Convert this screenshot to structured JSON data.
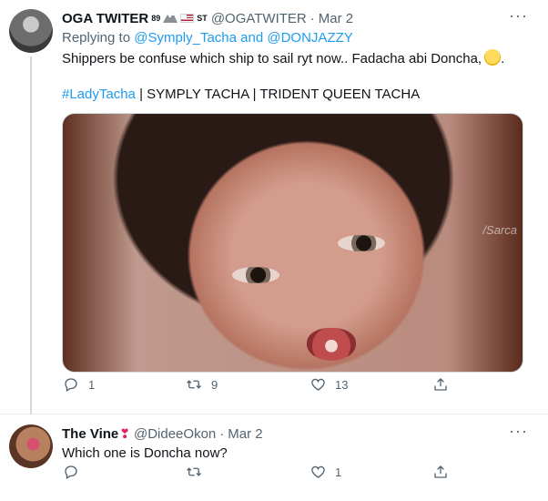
{
  "tweets": [
    {
      "author": {
        "name": "OGA TWITER",
        "superscript": "89",
        "rank": "ST",
        "handle": "@OGATWITER"
      },
      "date": "Mar 2",
      "reply_prefix": "Replying to",
      "reply_to": {
        "first": "@Symply_Tacha",
        "connector": "and",
        "second": "@DONJAZZY"
      },
      "text": "Shippers be confuse which ship to sail ryt now.. Fadacha abi Doncha,",
      "text_end": ".",
      "hashtag": "#LadyTacha",
      "tags_rest": "| SYMPLY TACHA | TRIDENT QUEEN TACHA",
      "media_watermark": "/Sarca",
      "actions": {
        "reply": "1",
        "retweet": "9",
        "like": "13"
      }
    },
    {
      "author": {
        "name": "The Vine",
        "handle": "@DideeOkon"
      },
      "date": "Mar 2",
      "text": "Which one is Doncha now?",
      "actions": {
        "reply": "",
        "retweet": "",
        "like": "1"
      }
    }
  ],
  "ui": {
    "dot": "·",
    "menu": "···"
  },
  "icons": {
    "reply": "reply-icon",
    "retweet": "retweet-icon",
    "like": "heart-outline-icon",
    "share": "share-icon",
    "menu": "more-icon"
  },
  "colors": {
    "accent": "#1d9bf0",
    "muted": "#536471",
    "text": "#0f1419",
    "divider": "#e6ecf0"
  }
}
